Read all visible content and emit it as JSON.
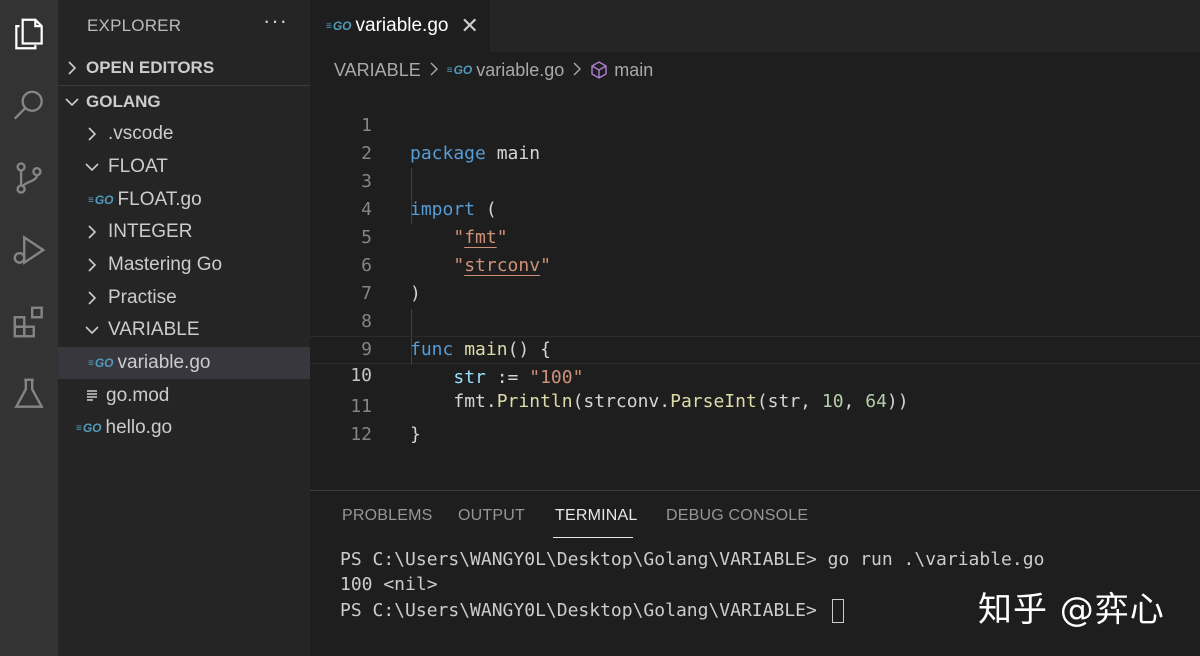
{
  "activity_bar": {
    "items": [
      "explorer-icon",
      "search-icon",
      "source-control-icon",
      "run-debug-icon",
      "extensions-icon",
      "testing-icon"
    ]
  },
  "sidebar": {
    "title": "EXPLORER",
    "more": "···",
    "open_editors": "OPEN EDITORS",
    "workspace": "GOLANG",
    "tree": [
      {
        "label": ".vscode",
        "type": "folder-collapsed"
      },
      {
        "label": "FLOAT",
        "type": "folder-expanded"
      },
      {
        "label": "FLOAT.go",
        "type": "go-file"
      },
      {
        "label": "INTEGER",
        "type": "folder-collapsed"
      },
      {
        "label": "Mastering Go",
        "type": "folder-collapsed"
      },
      {
        "label": "Practise",
        "type": "folder-collapsed"
      },
      {
        "label": "VARIABLE",
        "type": "folder-expanded"
      },
      {
        "label": "variable.go",
        "type": "go-file",
        "selected": true
      },
      {
        "label": "go.mod",
        "type": "mod-file"
      },
      {
        "label": "hello.go",
        "type": "go-file"
      }
    ],
    "go_badge": "GO"
  },
  "editor": {
    "tab_label": "variable.go",
    "tab_close": "✕",
    "breadcrumb": {
      "folder": "VARIABLE",
      "file": "variable.go",
      "symbol": "main"
    },
    "current_line": 10,
    "lines": [
      {
        "n": "1",
        "text": "package main"
      },
      {
        "n": "2",
        "text": ""
      },
      {
        "n": "3",
        "text": "import ("
      },
      {
        "n": "4",
        "text": "    \"fmt\""
      },
      {
        "n": "5",
        "text": "    \"strconv\""
      },
      {
        "n": "6",
        "text": ")"
      },
      {
        "n": "7",
        "text": ""
      },
      {
        "n": "8",
        "text": "func main() {"
      },
      {
        "n": "9",
        "text": "    str := \"100\""
      },
      {
        "n": "10",
        "text": "    fmt.Println(strconv.ParseInt(str, 10, 64))"
      },
      {
        "n": "11",
        "text": "}"
      },
      {
        "n": "12",
        "text": ""
      }
    ]
  },
  "panel": {
    "tabs": [
      "PROBLEMS",
      "OUTPUT",
      "TERMINAL",
      "DEBUG CONSOLE"
    ],
    "active_tab": "TERMINAL",
    "terminal": [
      "PS C:\\Users\\WANGY0L\\Desktop\\Golang\\VARIABLE> go run .\\variable.go",
      "100 <nil>",
      "PS C:\\Users\\WANGY0L\\Desktop\\Golang\\VARIABLE> "
    ]
  },
  "watermark": "知乎 @弈心"
}
